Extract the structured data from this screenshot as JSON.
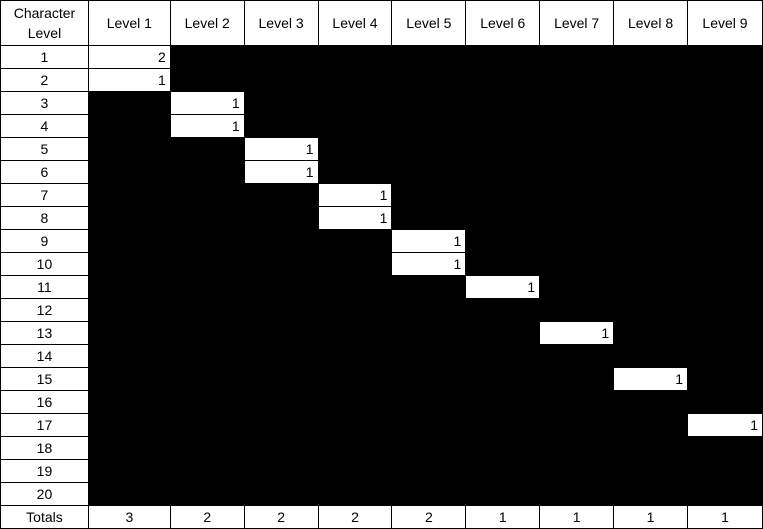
{
  "header": {
    "first": "Character Level",
    "levels": [
      "Level 1",
      "Level 2",
      "Level 3",
      "Level 4",
      "Level 5",
      "Level 6",
      "Level 7",
      "Level 8",
      "Level 9"
    ]
  },
  "rows": [
    {
      "level": "1",
      "cells": {
        "0": "2"
      }
    },
    {
      "level": "2",
      "cells": {
        "0": "1"
      }
    },
    {
      "level": "3",
      "cells": {
        "1": "1"
      }
    },
    {
      "level": "4",
      "cells": {
        "1": "1"
      }
    },
    {
      "level": "5",
      "cells": {
        "2": "1"
      }
    },
    {
      "level": "6",
      "cells": {
        "2": "1"
      }
    },
    {
      "level": "7",
      "cells": {
        "3": "1"
      }
    },
    {
      "level": "8",
      "cells": {
        "3": "1"
      }
    },
    {
      "level": "9",
      "cells": {
        "4": "1"
      }
    },
    {
      "level": "10",
      "cells": {
        "4": "1"
      }
    },
    {
      "level": "11",
      "cells": {
        "5": "1"
      }
    },
    {
      "level": "12",
      "cells": {}
    },
    {
      "level": "13",
      "cells": {
        "6": "1"
      }
    },
    {
      "level": "14",
      "cells": {}
    },
    {
      "level": "15",
      "cells": {
        "7": "1"
      }
    },
    {
      "level": "16",
      "cells": {}
    },
    {
      "level": "17",
      "cells": {
        "8": "1"
      }
    },
    {
      "level": "18",
      "cells": {}
    },
    {
      "level": "19",
      "cells": {}
    },
    {
      "level": "20",
      "cells": {}
    }
  ],
  "totals": {
    "label": "Totals",
    "values": [
      "3",
      "2",
      "2",
      "2",
      "2",
      "1",
      "1",
      "1",
      "1"
    ]
  },
  "colors": {
    "filled": "#000000",
    "open": "#ffffff"
  }
}
